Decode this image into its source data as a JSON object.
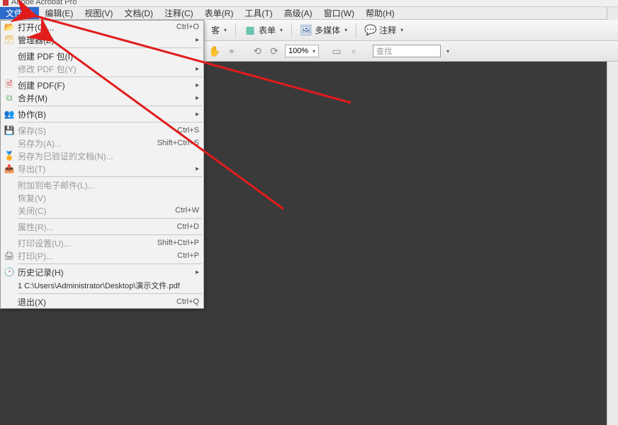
{
  "title": "Adobe Acrobat Pro",
  "menubar": {
    "items": [
      {
        "label": "文件(F)",
        "active": true
      },
      {
        "label": "编辑(E)"
      },
      {
        "label": "视图(V)"
      },
      {
        "label": "文档(D)"
      },
      {
        "label": "注释(C)"
      },
      {
        "label": "表单(R)"
      },
      {
        "label": "工具(T)"
      },
      {
        "label": "高级(A)"
      },
      {
        "label": "窗口(W)"
      },
      {
        "label": "帮助(H)"
      }
    ]
  },
  "toolbar1": {
    "guest": "客",
    "form": "表单",
    "multimedia": "多媒体",
    "comment": "注释"
  },
  "toolbar2": {
    "zoom": "100%",
    "search_placeholder": "查找"
  },
  "file_menu": {
    "open": {
      "label": "打开(O)...",
      "shortcut": "Ctrl+O"
    },
    "organizer": {
      "label": "管理器(Z)"
    },
    "create_portfolio": {
      "label": "创建 PDF 包(I)"
    },
    "modify_portfolio": {
      "label": "修改 PDF 包(Y)"
    },
    "create_pdf": {
      "label": "创建 PDF(F)"
    },
    "combine": {
      "label": "合并(M)"
    },
    "collaborate": {
      "label": "协作(B)"
    },
    "save": {
      "label": "保存(S)",
      "shortcut": "Ctrl+S"
    },
    "save_as": {
      "label": "另存为(A)...",
      "shortcut": "Shift+Ctrl+S"
    },
    "save_certified": {
      "label": "另存为已验证的文档(N)..."
    },
    "export": {
      "label": "导出(T)"
    },
    "attach_email": {
      "label": "附加到电子邮件(L)..."
    },
    "revert": {
      "label": "恢复(V)"
    },
    "close": {
      "label": "关闭(C)",
      "shortcut": "Ctrl+W"
    },
    "properties": {
      "label": "属性(R)...",
      "shortcut": "Ctrl+D"
    },
    "print_setup": {
      "label": "打印设置(U)...",
      "shortcut": "Shift+Ctrl+P"
    },
    "print": {
      "label": "打印(P)...",
      "shortcut": "Ctrl+P"
    },
    "history": {
      "label": "历史记录(H)"
    },
    "recent1": {
      "label": "1 C:\\Users\\Administrator\\Desktop\\演示文件.pdf"
    },
    "exit": {
      "label": "退出(X)",
      "shortcut": "Ctrl+Q"
    }
  }
}
